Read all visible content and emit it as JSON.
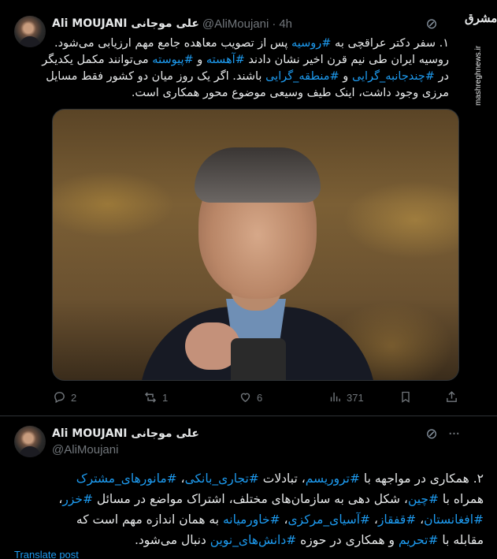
{
  "tweet1": {
    "author_name": "Ali MOUJANI علی موجانی",
    "handle": "@AliMoujani",
    "time": "4h",
    "lines": [
      [
        {
          "t": "۱. سفر دکتر عراقچی به "
        },
        {
          "t": "#روسیه",
          "h": true
        },
        {
          "t": " پس از تصویب معاهده جامع مهم ارزیابی می‌شود."
        }
      ],
      [
        {
          "t": "روسیه ایران طی نیم قرن اخیر نشان دادند "
        },
        {
          "t": "#آهسته",
          "h": true
        },
        {
          "t": " و "
        },
        {
          "t": "#پیوسته",
          "h": true
        },
        {
          "t": " می‌توانند مکمل یکدیگر"
        }
      ],
      [
        {
          "t": "در "
        },
        {
          "t": "#چندجانبه_گرایی",
          "h": true
        },
        {
          "t": " و "
        },
        {
          "t": "#منطقه_گرایی",
          "h": true
        },
        {
          "t": " باشند. اگر یک روز میان دو کشور فقط مسایل"
        }
      ],
      [
        {
          "t": "مرزی وجود داشت، اینک طیف وسیعی موضوع محور همکاری است."
        }
      ]
    ],
    "stats": {
      "replies": "2",
      "reposts": "1",
      "likes": "6",
      "views": "371"
    }
  },
  "watermark": {
    "logo": "مشرق",
    "url": "mashreghnews.ir"
  },
  "tweet2": {
    "author_name": "Ali MOUJANI علی موجانی",
    "handle": "@AliMoujani",
    "lines": [
      [
        {
          "t": "۲. همکاری در مواجهه با "
        },
        {
          "t": "#تروریسم",
          "h": true
        },
        {
          "t": "، تبادلات "
        },
        {
          "t": "#تجاری_بانکی",
          "h": true
        },
        {
          "t": "، "
        },
        {
          "t": "#مانورهای_مشترک",
          "h": true
        }
      ],
      [
        {
          "t": "همراه با "
        },
        {
          "t": "#چین",
          "h": true
        },
        {
          "t": "، شکل دهی به سازمان‌های مختلف، اشتراک مواضع در مسائل "
        },
        {
          "t": "#خزر",
          "h": true
        },
        {
          "t": "،"
        }
      ],
      [
        {
          "t": "#افغانستان",
          "h": true
        },
        {
          "t": "، "
        },
        {
          "t": "#قفقاز",
          "h": true
        },
        {
          "t": "، "
        },
        {
          "t": "#آسیای_مرکزی",
          "h": true
        },
        {
          "t": "، "
        },
        {
          "t": "#خاورمیانه",
          "h": true
        },
        {
          "t": " به همان اندازه مهم است که"
        }
      ],
      [
        {
          "t": "مقابله با "
        },
        {
          "t": "#تحریم",
          "h": true
        },
        {
          "t": " و همکاری در حوزه "
        },
        {
          "t": "#دانش‌های_نوین",
          "h": true
        },
        {
          "t": " دنبال می‌شود."
        }
      ]
    ]
  },
  "translate_label": "Translate post",
  "colors": {
    "background": "#000000",
    "text": "#e7e9ea",
    "muted": "#71767b",
    "link": "#1d9bf0",
    "divider": "#2f3336"
  }
}
